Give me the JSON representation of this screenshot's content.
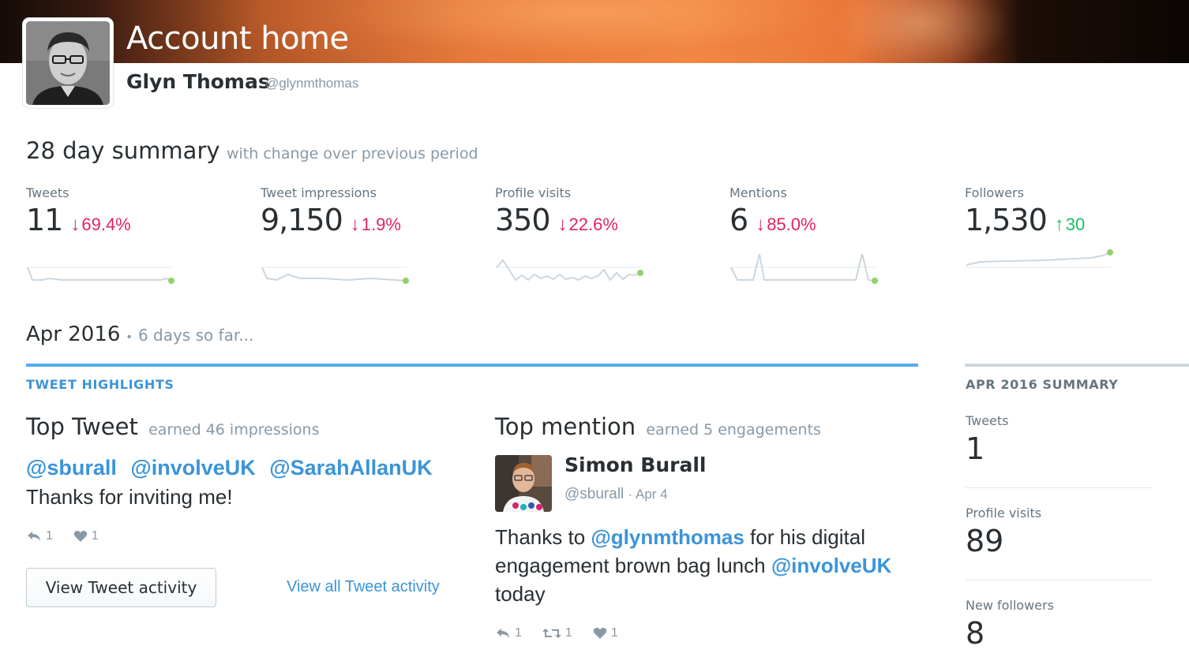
{
  "header": {
    "title": "Account home",
    "user_name": "Glyn Thomas",
    "user_handle": "@glynmthomas"
  },
  "summary": {
    "title": "28 day summary",
    "subtitle": "with change over previous period",
    "stats": [
      {
        "label": "Tweets",
        "value": "11",
        "change": "69.4%",
        "direction": "down"
      },
      {
        "label": "Tweet impressions",
        "value": "9,150",
        "change": "1.9%",
        "direction": "down"
      },
      {
        "label": "Profile visits",
        "value": "350",
        "change": "22.6%",
        "direction": "down"
      },
      {
        "label": "Mentions",
        "value": "6",
        "change": "85.0%",
        "direction": "down"
      },
      {
        "label": "Followers",
        "value": "1,530",
        "change": "30",
        "direction": "up"
      }
    ]
  },
  "period": {
    "title": "Apr 2016",
    "bullet": "•",
    "subtitle": "6 days so far..."
  },
  "highlights": {
    "section_label": "TWEET HIGHLIGHTS",
    "top_tweet": {
      "title": "Top Tweet",
      "subtitle": "earned 46 impressions",
      "mentions": [
        "@sburall",
        "@involveUK",
        "@SarahAllanUK"
      ],
      "text": "Thanks for inviting me!",
      "replies": "1",
      "likes": "1"
    },
    "view_button": "View Tweet activity",
    "view_all_link": "View all Tweet activity",
    "top_mention": {
      "title": "Top mention",
      "subtitle": "earned 5 engagements",
      "name": "Simon Burall",
      "handle": "@sburall",
      "date": "· Apr 4",
      "text_1": "Thanks to ",
      "mention_1": "@glynmthomas",
      "text_2": " for his digital engagement brown bag lunch ",
      "mention_2": "@involveUK",
      "text_3": " today",
      "replies": "1",
      "retweets": "1",
      "likes": "1"
    }
  },
  "apr_summary": {
    "section_label": "APR 2016 SUMMARY",
    "stats": [
      {
        "label": "Tweets",
        "value": "1"
      },
      {
        "label": "Profile visits",
        "value": "89"
      },
      {
        "label": "New followers",
        "value": "8"
      }
    ]
  },
  "colors": {
    "accent_blue": "#3b94d9",
    "down_red": "#e0245e",
    "up_green": "#17bf63",
    "spark_line": "#ccd6dd",
    "spark_dot": "#8fd26b"
  }
}
